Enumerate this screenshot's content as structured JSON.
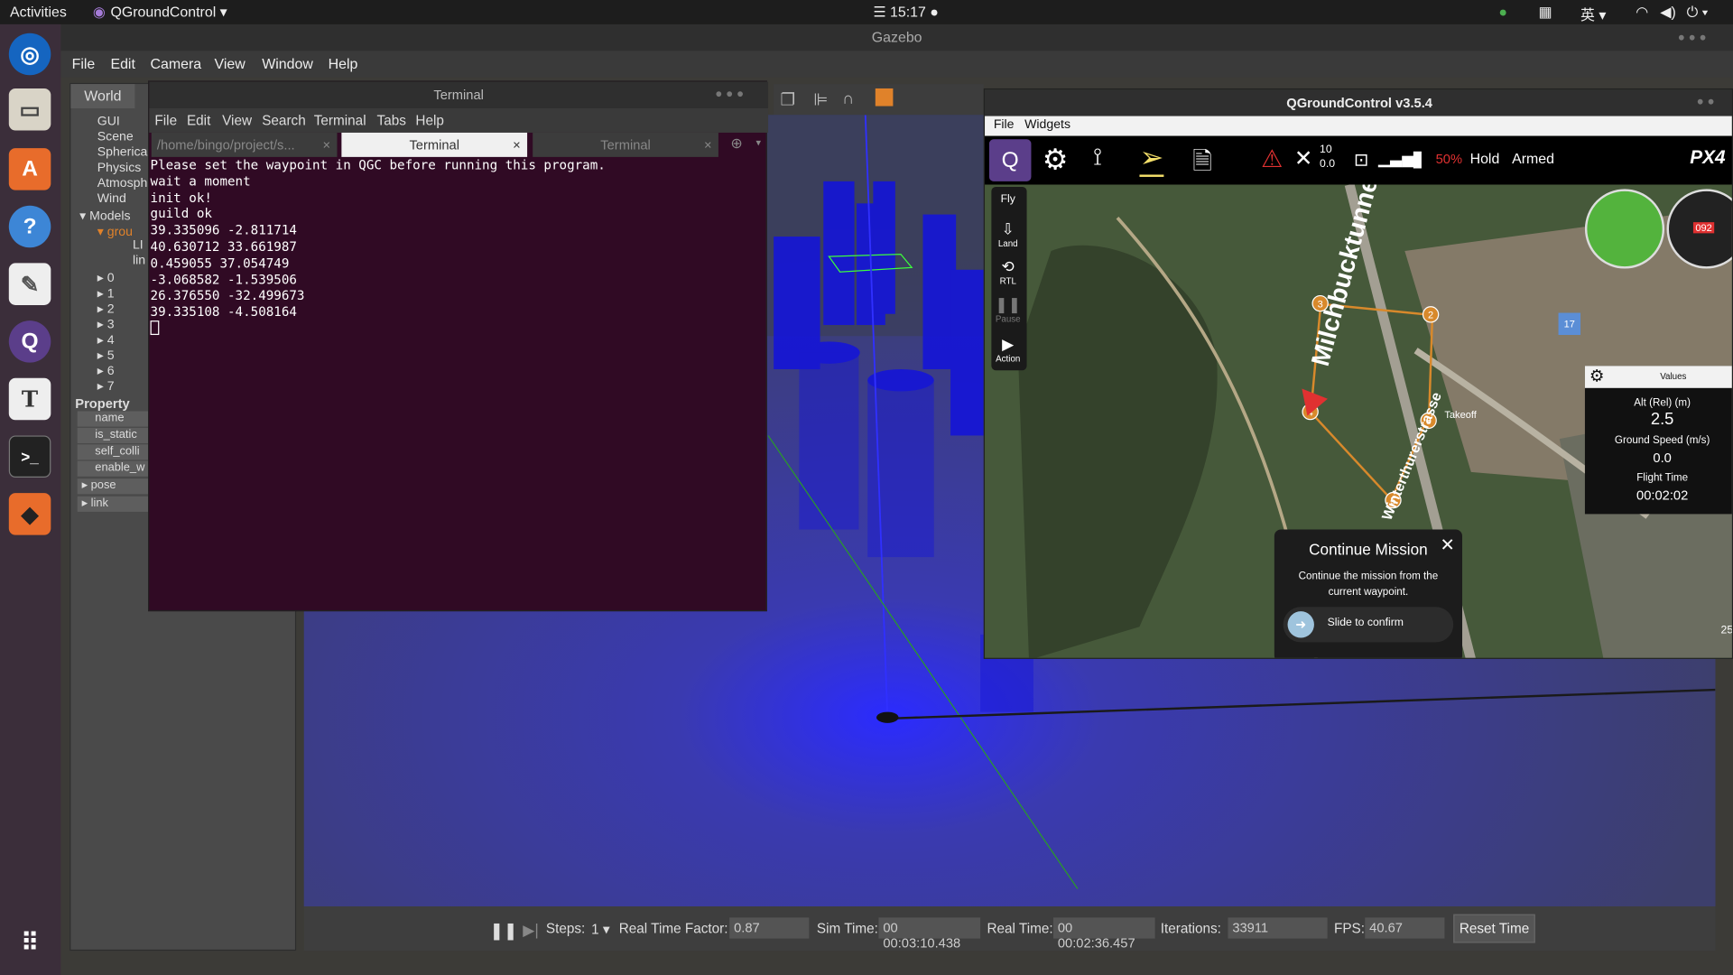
{
  "topbar": {
    "activities": "Activities",
    "app": "QGroundControl ▾",
    "clock": "☰ 15:17 ●",
    "lang": "英 ▾"
  },
  "gazebo": {
    "title": "Gazebo",
    "menu": [
      "File",
      "Edit",
      "Camera",
      "View",
      "Window",
      "Help"
    ],
    "world_tab": "World",
    "tree": [
      "GUI",
      "Scene",
      "Spherica",
      "Physics",
      "Atmosph",
      "Wind"
    ],
    "models": "Models",
    "model_item": "grou",
    "model_sub": [
      "LI",
      "lin"
    ],
    "nums": [
      "0",
      "1",
      "2",
      "3",
      "4",
      "5",
      "6",
      "7"
    ],
    "property": "Property",
    "props": [
      "name",
      "is_static",
      "self_colli",
      "enable_w",
      "pose",
      "link"
    ],
    "status": {
      "steps_label": "Steps:",
      "steps": "1 ▾",
      "rtf_label": "Real Time Factor:",
      "rtf": "0.87",
      "sim_label": "Sim Time:",
      "sim": "00 00:03:10.438",
      "real_label": "Real Time:",
      "real": "00 00:02:36.457",
      "iter_label": "Iterations:",
      "iter": "33911",
      "fps_label": "FPS:",
      "fps": "40.67",
      "reset": "Reset Time"
    }
  },
  "terminal": {
    "title": "Terminal",
    "menu": [
      "File",
      "Edit",
      "View",
      "Search",
      "Terminal",
      "Tabs",
      "Help"
    ],
    "tabs": [
      "/home/bingo/project/s...",
      "Terminal",
      "Terminal"
    ],
    "lines": "Please set the waypoint in QGC before running this program.\nwait a moment\ninit ok!\nguild ok\n39.335096 -2.811714\n40.630712 33.661987\n0.459055 37.054749\n-3.068582 -1.539506\n26.376550 -32.499673\n39.335108 -4.508164"
  },
  "qgc": {
    "title": "QGroundControl v3.5.4",
    "menu": [
      "File",
      "Widgets"
    ],
    "sats": "10",
    "hdop": "0.0",
    "battery": "50%",
    "mode": "Hold",
    "armed": "Armed",
    "brand": "PX4",
    "fly": "Fly",
    "land": "Land",
    "rtl": "RTL",
    "pause": "Pause",
    "action": "Action",
    "waypoints": [
      "2",
      "3",
      "4",
      "5",
      "6"
    ],
    "takeoff": "Takeoff",
    "street1": "Milchbucktunnel",
    "street2": "Winterthurerstrasse",
    "compass": "092",
    "values_title": "Values",
    "alt_label": "Alt (Rel) (m)",
    "alt": "2.5",
    "gs_label": "Ground Speed (m/s)",
    "gs": "0.0",
    "ft_label": "Flight Time",
    "ft": "00:02:02",
    "continue_title": "Continue Mission",
    "continue_text": "Continue the mission from the current waypoint.",
    "slide": "Slide to confirm",
    "scale": "25"
  },
  "colors": {
    "terminal_bg": "#300a24",
    "accent": "#d8892b",
    "alarm": "#e03131"
  }
}
